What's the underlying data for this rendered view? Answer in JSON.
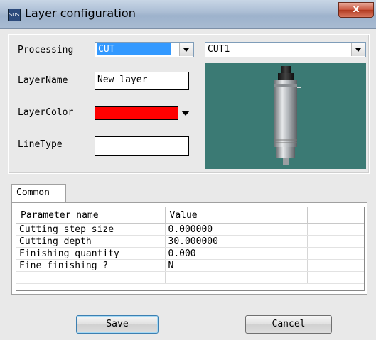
{
  "window": {
    "title": "Layer configuration",
    "app_icon": "app-logo-icon",
    "close_label": "x"
  },
  "form": {
    "processing_label": "Processing",
    "processing_value": "CUT",
    "tool_value": "CUT1",
    "layername_label": "LayerName",
    "layername_value": "New layer",
    "layercolor_label": "LayerColor",
    "layercolor_value": "#ff0000",
    "linetype_label": "LineType"
  },
  "tabs": [
    {
      "label": "Common"
    }
  ],
  "grid": {
    "headers": [
      "Parameter name",
      "Value"
    ],
    "rows": [
      [
        "Cutting step size",
        "0.000000"
      ],
      [
        "Cutting depth",
        "30.000000"
      ],
      [
        "Finishing quantity",
        "0.000"
      ],
      [
        "Fine finishing ?",
        "N"
      ]
    ]
  },
  "buttons": {
    "save_label": "Save",
    "cancel_label": "Cancel"
  },
  "colors": {
    "titlebar": "#a9bcd3",
    "selection_highlight": "#3399ff",
    "preview_background": "#3b7a74",
    "close_button": "#c8523b"
  }
}
